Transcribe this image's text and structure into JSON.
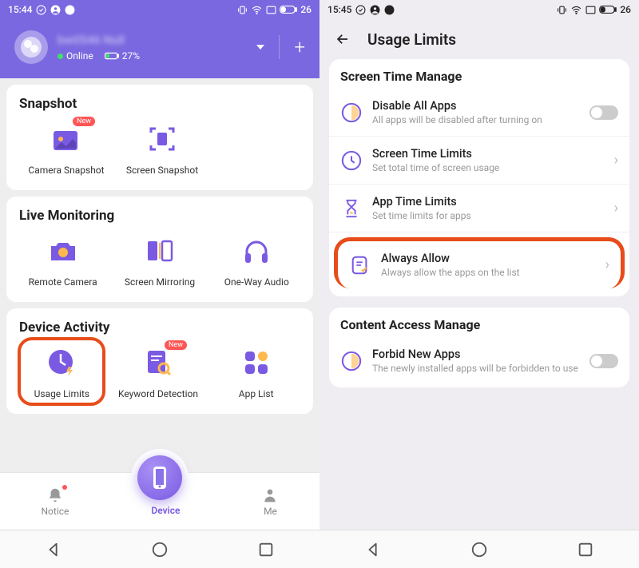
{
  "left": {
    "status": {
      "time": "15:44",
      "battery": "26"
    },
    "header": {
      "username": "bw0546 Null",
      "online_label": "Online",
      "battery_label": "27%"
    },
    "sections": {
      "snapshot": {
        "title": "Snapshot",
        "items": [
          {
            "label": "Camera Snapshot"
          },
          {
            "label": "Screen Snapshot"
          }
        ]
      },
      "live": {
        "title": "Live Monitoring",
        "items": [
          {
            "label": "Remote Camera"
          },
          {
            "label": "Screen Mirroring"
          },
          {
            "label": "One-Way Audio"
          }
        ]
      },
      "activity": {
        "title": "Device Activity",
        "items": [
          {
            "label": "Usage Limits"
          },
          {
            "label": "Keyword Detection"
          },
          {
            "label": "App List"
          }
        ]
      }
    },
    "tabs": {
      "notice": "Notice",
      "device": "Device",
      "me": "Me"
    }
  },
  "right": {
    "status": {
      "time": "15:45",
      "battery": "26"
    },
    "page_title": "Usage Limits",
    "screen_time": {
      "section": "Screen Time Manage",
      "items": [
        {
          "title": "Disable All Apps",
          "sub": "All apps will be disabled after turning on"
        },
        {
          "title": "Screen Time Limits",
          "sub": "Set total time of screen usage"
        },
        {
          "title": "App Time Limits",
          "sub": "Set time limits for apps"
        },
        {
          "title": "Always Allow",
          "sub": "Always allow the apps on the list"
        }
      ]
    },
    "content_access": {
      "section": "Content Access Manage",
      "items": [
        {
          "title": "Forbid New Apps",
          "sub": "The newly installed apps will be forbidden to use"
        }
      ]
    }
  }
}
